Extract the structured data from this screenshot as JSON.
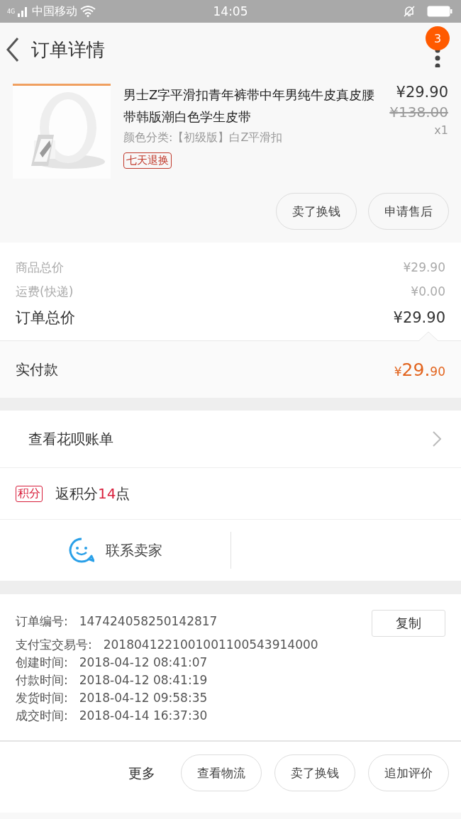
{
  "status_bar": {
    "network": "4G",
    "carrier": "中国移动",
    "time": "14:05"
  },
  "header": {
    "title": "订单详情",
    "badge": "3"
  },
  "product": {
    "title": "男士Z字平滑扣青年裤带中年男纯牛皮真皮腰带韩版潮白色学生皮带",
    "price": "¥29.90",
    "original_price": "¥138.00",
    "sku": "颜色分类:【初级版】白Z平滑扣",
    "quantity": "x1",
    "tag": "七天退换"
  },
  "product_actions": [
    "卖了换钱",
    "申请售后"
  ],
  "summary": [
    {
      "label": "商品总价",
      "value": "¥29.90",
      "kind": "minor"
    },
    {
      "label": "运费(快递)",
      "value": "¥0.00",
      "kind": "minor"
    },
    {
      "label": "订单总价",
      "value": "¥29.90",
      "kind": "total"
    }
  ],
  "paid": {
    "label": "实付款",
    "currency": "¥",
    "main": "29.",
    "fraction": "90"
  },
  "huabei": {
    "label": "查看花呗账单"
  },
  "points": {
    "badge": "积分",
    "prefix": "返积分",
    "number": "14",
    "suffix": "点"
  },
  "contact": {
    "label": "联系卖家"
  },
  "order_info": {
    "copy_button": "复制",
    "rows": [
      {
        "label": "订单编号:",
        "value": "147424058250142817"
      },
      {
        "label": "支付宝交易号:",
        "value": "2018041221001001100543914000"
      },
      {
        "label": "创建时间:",
        "value": "2018-04-12 08:41:07"
      },
      {
        "label": "付款时间:",
        "value": "2018-04-12 08:41:19"
      },
      {
        "label": "发货时间:",
        "value": "2018-04-12 09:58:35"
      },
      {
        "label": "成交时间:",
        "value": "2018-04-14 16:37:30"
      }
    ]
  },
  "bottom_bar": {
    "more": "更多",
    "buttons": [
      "查看物流",
      "卖了换钱",
      "追加评价"
    ]
  }
}
